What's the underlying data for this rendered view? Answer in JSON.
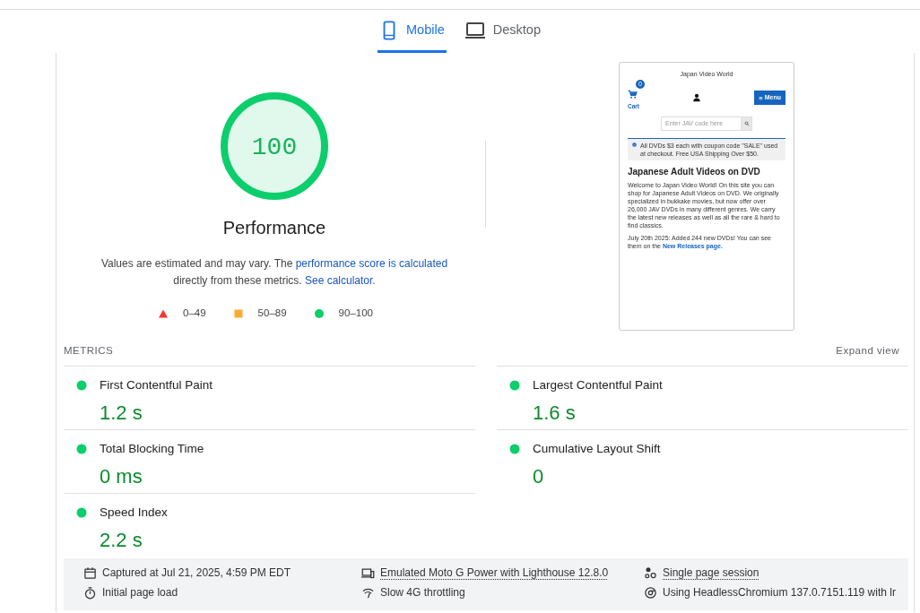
{
  "tabs": [
    {
      "label": "Mobile",
      "kind": "phone",
      "selected": true
    },
    {
      "label": "Desktop",
      "kind": "laptop",
      "selected": false
    }
  ],
  "score": {
    "value": "100",
    "level": 1.0,
    "color": "#0cce6b",
    "title": "Performance"
  },
  "description": {
    "before": "Values are estimated and may vary. The ",
    "link": "performance score is calculated",
    "middle": " directly from these metrics. ",
    "link2": "See calculator."
  },
  "legend": [
    {
      "kind": "triangle",
      "color": "#ff3333",
      "label": "0–49"
    },
    {
      "kind": "square",
      "color": "#ffaa33",
      "label": "50–89"
    },
    {
      "kind": "circle",
      "color": "#0cce6b",
      "label": "90–100"
    }
  ],
  "preview": {
    "site_title": "Japan Video World",
    "cart_count": "0",
    "cart_label": "Cart",
    "menu": "Menu",
    "search_placeholder": "Enter JAV code here",
    "notice": "All DVDs $3 each with coupon code \"SALE\" used at checkout. Free USA Shipping Over $50.",
    "heading": "Japanese Adult Videos on DVD",
    "intro": "Welcome to Japan Video World! On this site you can shop for Japanese Adult Videos on DVD. We originally specialized in bukkake movies, but now offer over 26,000 JAV DVDs in many different genres. We carry the latest new releases as well as all the rare & hard to find classics.",
    "news": "July 20th 2025: Added 244 new DVDs! You can see them on the ",
    "news_link": "New Releases page."
  },
  "metrics": {
    "label": "METRICS",
    "expand": "Expand view",
    "items": [
      {
        "name": "First Contentful Paint",
        "value": "1.2 s",
        "color": "#0cce6b"
      },
      {
        "name": "Largest Contentful Paint",
        "value": "1.6 s",
        "color": "#0cce6b"
      },
      {
        "name": "Total Blocking Time",
        "value": "0 ms",
        "color": "#0cce6b"
      },
      {
        "name": "Cumulative Layout Shift",
        "value": "0",
        "color": "#0cce6b"
      },
      {
        "name": "Speed Index",
        "value": "2.2 s",
        "color": "#0cce6b"
      }
    ]
  },
  "footer": [
    {
      "kind": "calendar",
      "text": "Captured at Jul 21, 2025, 4:59 PM EDT",
      "link": false
    },
    {
      "kind": "devices",
      "text": "Emulated Moto G Power with Lighthouse 12.8.0",
      "link": true
    },
    {
      "kind": "dots",
      "text": "Single page session",
      "link": true
    },
    {
      "kind": "timer",
      "text": "Initial page load",
      "link": false
    },
    {
      "kind": "signal",
      "text": "Slow 4G throttling",
      "link": false
    },
    {
      "kind": "browser",
      "text": "Using HeadlessChromium 137.0.7151.119 with lr",
      "link": false
    }
  ]
}
